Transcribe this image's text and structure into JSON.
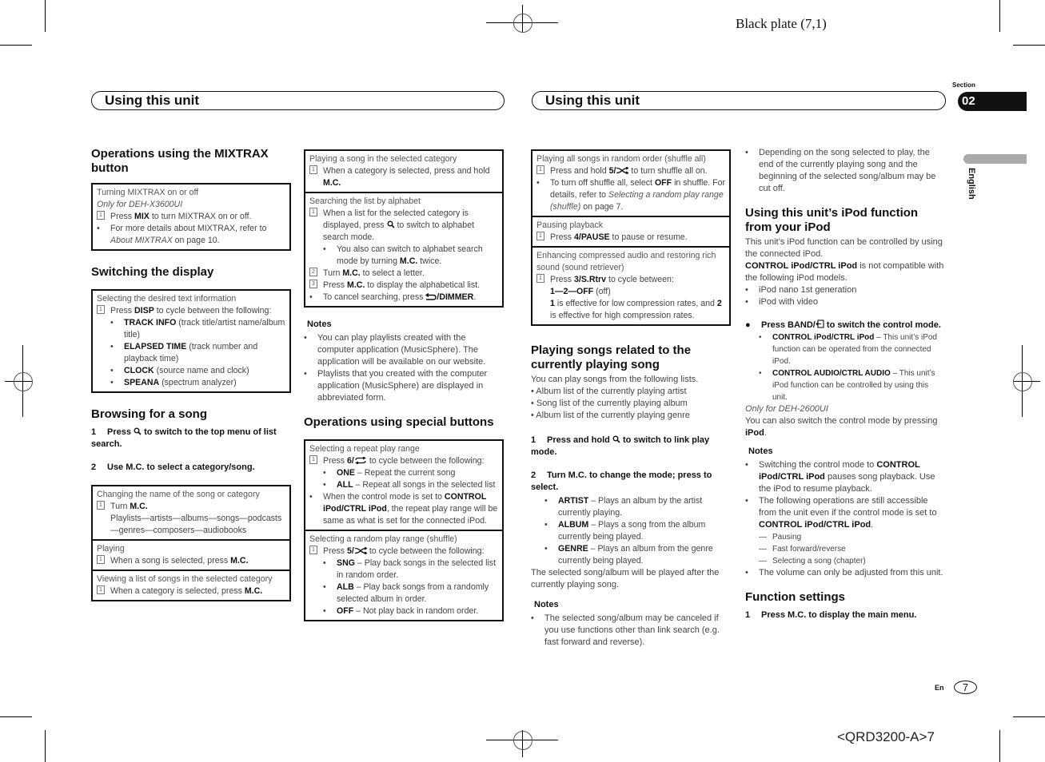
{
  "print_marks": {
    "plate_label": "Black plate (7,1)",
    "job_code": "<QRD3200-A>7"
  },
  "header": {
    "left_title": "Using this unit",
    "right_title": "Using this unit",
    "section_label": "Section",
    "section_number": "02",
    "language_tab": "English"
  },
  "footer": {
    "lang_code": "En",
    "page_number": "7"
  },
  "icons": {
    "search": "search-icon",
    "repeat": "repeat-icon",
    "shuffle": "shuffle-icon",
    "back_dimmer": "back-dimmer-icon",
    "band_return": "band-return-icon"
  },
  "col1": {
    "mixtrax_heading": "Operations using the MIXTRAX button",
    "mixtrax_box": {
      "title": "Turning MIXTRAX on or off",
      "model_note": "Only for DEH-X3600UI",
      "step1": [
        {
          "t": "Press "
        },
        {
          "b": "MIX"
        },
        {
          "t": " to turn MIXTRAX on or off."
        }
      ],
      "bullet1": [
        {
          "t": "For more details about MIXTRAX, refer to "
        },
        {
          "i": "About MIXTRAX"
        },
        {
          "t": " on page 10."
        }
      ]
    },
    "display_heading": "Switching the display",
    "display_box": {
      "title": "Selecting the desired text information",
      "step1": [
        {
          "t": "Press "
        },
        {
          "b": "DISP"
        },
        {
          "t": " to cycle between the following:"
        }
      ],
      "options": [
        [
          {
            "b": "TRACK INFO"
          },
          {
            "t": " (track title/artist name/album title)"
          }
        ],
        [
          {
            "b": "ELAPSED TIME"
          },
          {
            "t": " (track number and playback time)"
          }
        ],
        [
          {
            "b": "CLOCK"
          },
          {
            "t": " (source name and clock)"
          }
        ],
        [
          {
            "b": "SPEANA"
          },
          {
            "t": " (spectrum analyzer)"
          }
        ]
      ]
    },
    "browse_heading": "Browsing for a song",
    "browse_steps": [
      {
        "n": "1",
        "text": [
          {
            "t": "Press "
          },
          {
            "icon": "search"
          },
          {
            "t": " to switch to the top menu of list search."
          }
        ]
      },
      {
        "n": "2",
        "text": [
          {
            "t": "Use M.C. to select a category/song."
          }
        ]
      }
    ],
    "browse_boxes": [
      {
        "title": "Changing the name of the song or category",
        "step1": [
          {
            "t": "Turn "
          },
          {
            "b": "M.C."
          }
        ],
        "extra": "Playlists—artists—albums—songs—podcasts—genres—composers—audiobooks"
      },
      {
        "title": "Playing",
        "step1": [
          {
            "t": "When a song is selected, press "
          },
          {
            "b": "M.C."
          }
        ]
      },
      {
        "title": "Viewing a list of songs in the selected category",
        "step1": [
          {
            "t": "When a category is selected, press "
          },
          {
            "b": "M.C."
          }
        ]
      }
    ]
  },
  "col2": {
    "play_cat_box": {
      "title": "Playing a song in the selected category",
      "step1": [
        {
          "t": "When a category is selected, press and hold "
        },
        {
          "b": "M.C."
        }
      ]
    },
    "alpha_box": {
      "title": "Searching the list by alphabet",
      "step1": [
        {
          "t": "When a list for the selected category is displayed, press "
        },
        {
          "icon": "search"
        },
        {
          "t": " to switch to alphabet search mode."
        }
      ],
      "sub1": [
        {
          "t": "You also can switch to alphabet search mode by turning "
        },
        {
          "b": "M.C."
        },
        {
          "t": " twice."
        }
      ],
      "step2": [
        {
          "t": "Turn "
        },
        {
          "b": "M.C."
        },
        {
          "t": " to select a letter."
        }
      ],
      "step3": [
        {
          "t": "Press "
        },
        {
          "b": "M.C."
        },
        {
          "t": " to display the alphabetical list."
        }
      ],
      "bullet": [
        {
          "t": "To cancel searching, press "
        },
        {
          "icon": "back_dimmer"
        },
        {
          "b": "/DIMMER"
        },
        {
          "t": "."
        }
      ]
    },
    "notes_heading": "Notes",
    "notes": [
      [
        {
          "t": "You can play playlists created with the computer application (MusicSphere). The application will be available on our website."
        }
      ],
      [
        {
          "t": "Playlists that you created with the computer application (MusicSphere) are displayed in abbreviated form."
        }
      ]
    ],
    "special_heading": "Operations using special buttons",
    "repeat_box": {
      "title": "Selecting a repeat play range",
      "step1": [
        {
          "t": "Press "
        },
        {
          "b": "6/"
        },
        {
          "icon": "repeat"
        },
        {
          "t": " to cycle between the following:"
        }
      ],
      "options": [
        [
          {
            "b": "ONE"
          },
          {
            "t": " – Repeat the current song"
          }
        ],
        [
          {
            "b": "ALL"
          },
          {
            "t": " – Repeat all songs in the selected list"
          }
        ]
      ],
      "bullet": [
        {
          "t": "When the control mode is set to "
        },
        {
          "b": "CONTROL iPod/CTRL iPod"
        },
        {
          "t": ", the repeat play range will be same as what is set for the connected iPod."
        }
      ]
    },
    "shuffle_box": {
      "title": "Selecting a random play range (shuffle)",
      "step1": [
        {
          "t": "Press "
        },
        {
          "b": "5/"
        },
        {
          "icon": "shuffle"
        },
        {
          "t": " to cycle between the following:"
        }
      ],
      "options": [
        [
          {
            "b": "SNG"
          },
          {
            "t": " – Play back songs in the selected list in random order."
          }
        ],
        [
          {
            "b": "ALB"
          },
          {
            "t": " – Play back songs from a randomly selected album in order."
          }
        ],
        [
          {
            "b": "OFF"
          },
          {
            "t": " – Not play back in random order."
          }
        ]
      ]
    }
  },
  "col3": {
    "shuffle_all_box": {
      "title": "Playing all songs in random order (shuffle all)",
      "step1": [
        {
          "t": "Press and hold "
        },
        {
          "b": "5/"
        },
        {
          "icon": "shuffle"
        },
        {
          "t": " to turn shuffle all on."
        }
      ],
      "bullet": [
        {
          "t": "To turn off shuffle all, select "
        },
        {
          "b": "OFF"
        },
        {
          "t": " in shuffle. For details, refer to "
        },
        {
          "i": "Selecting a random play range (shuffle)"
        },
        {
          "t": " on page 7."
        }
      ]
    },
    "pause_box": {
      "title": "Pausing playback",
      "step1": [
        {
          "t": "Press "
        },
        {
          "b": "4/PAUSE"
        },
        {
          "t": " to pause or resume."
        }
      ]
    },
    "retriever_box": {
      "title": "Enhancing compressed audio and restoring rich sound (sound retriever)",
      "step1": [
        {
          "t": "Press "
        },
        {
          "b": "3/S.Rtrv"
        },
        {
          "t": " to cycle between:"
        }
      ],
      "cycle": [
        {
          "b": "1—2—OFF"
        },
        {
          "t": " (off)"
        }
      ],
      "detail": [
        {
          "b": "1"
        },
        {
          "t": " is effective for low compression rates, and "
        },
        {
          "b": "2"
        },
        {
          "t": " is effective for high compression rates."
        }
      ]
    },
    "link_heading": "Playing songs related to the currently playing song",
    "link_intro": "You can play songs from the following lists.",
    "link_lists": [
      "• Album list of the currently playing artist",
      "• Song list of the currently playing album",
      "• Album list of the currently playing genre"
    ],
    "link_steps": [
      {
        "n": "1",
        "text": [
          {
            "t": "Press and hold "
          },
          {
            "icon": "search"
          },
          {
            "t": " to switch to link play mode."
          }
        ]
      },
      {
        "n": "2",
        "text": [
          {
            "t": "Turn M.C. to change the mode; press to select."
          }
        ]
      }
    ],
    "link_modes": [
      [
        {
          "b": "ARTIST"
        },
        {
          "t": " – Plays an album by the artist currently playing."
        }
      ],
      [
        {
          "b": "ALBUM"
        },
        {
          "t": " – Plays a song from the album currently being played."
        }
      ],
      [
        {
          "b": "GENRE"
        },
        {
          "t": " – Plays an album from the genre currently being played."
        }
      ]
    ],
    "link_after": "The selected song/album will be played after the currently playing song.",
    "notes_heading": "Notes",
    "notes": [
      [
        {
          "t": "The selected song/album may be canceled if you use functions other than link search (e.g. fast forward and reverse)."
        }
      ]
    ]
  },
  "col4": {
    "top_note": [
      {
        "t": "Depending on the song selected to play, the end of the currently playing song and the beginning of the selected song/album may be cut off."
      }
    ],
    "ipod_heading": "Using this unit’s iPod function from your iPod",
    "ipod_intro": "This unit’s iPod function can be controlled by using the connected iPod.",
    "ipod_compat": [
      {
        "b": "CONTROL iPod/CTRL iPod"
      },
      {
        "t": " is not compatible with the following iPod models."
      }
    ],
    "ipod_models": [
      "iPod nano 1st generation",
      "iPod with video"
    ],
    "band_step": [
      {
        "t": "Press BAND/"
      },
      {
        "icon": "band_return"
      },
      {
        "t": " to switch the control mode."
      }
    ],
    "modes": [
      [
        {
          "b": "CONTROL iPod/CTRL iPod"
        },
        {
          "t": " – This unit’s iPod function can be operated from the connected iPod."
        }
      ],
      [
        {
          "b": "CONTROL AUDIO/CTRL AUDIO"
        },
        {
          "t": " – This unit’s iPod function can be controlled by using this unit."
        }
      ]
    ],
    "model_note": "Only for DEH-2600UI",
    "also_switch": [
      {
        "t": "You can also switch the control mode by pressing "
      },
      {
        "b": "iPod"
      },
      {
        "t": "."
      }
    ],
    "notes_heading": "Notes",
    "note1": [
      {
        "t": "Switching the control mode to "
      },
      {
        "b": "CONTROL iPod/CTRL iPod"
      },
      {
        "t": " pauses song playback. Use the iPod to resume playback."
      }
    ],
    "note2": [
      {
        "t": "The following operations are still accessible from the unit even if the control mode is set to "
      },
      {
        "b": "CONTROL iPod/CTRL iPod"
      },
      {
        "t": "."
      }
    ],
    "note2_items": [
      "Pausing",
      "Fast forward/reverse",
      "Selecting a song (chapter)"
    ],
    "note3": [
      {
        "t": "The volume can only be adjusted from this unit."
      }
    ],
    "func_heading": "Function settings",
    "func_steps": [
      {
        "n": "1",
        "text": [
          {
            "t": "Press M.C. to display the main menu."
          }
        ]
      }
    ]
  }
}
